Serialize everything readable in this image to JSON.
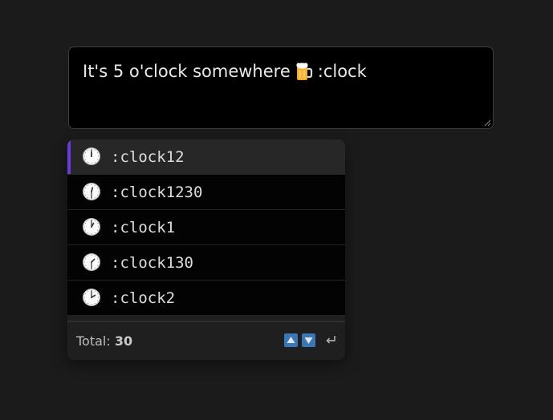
{
  "composer": {
    "text_before": "It's 5 o'clock somewhere",
    "emoji_icon": "beer-mug-icon",
    "text_after": ":clock"
  },
  "suggestions": [
    {
      "label": ":clock12",
      "icon": "clock-12-icon",
      "hour": 12,
      "minute": 0,
      "selected": true
    },
    {
      "label": ":clock1230",
      "icon": "clock-1230-icon",
      "hour": 12,
      "minute": 30,
      "selected": false
    },
    {
      "label": ":clock1",
      "icon": "clock-1-icon",
      "hour": 1,
      "minute": 0,
      "selected": false
    },
    {
      "label": ":clock130",
      "icon": "clock-130-icon",
      "hour": 1,
      "minute": 30,
      "selected": false
    },
    {
      "label": ":clock2",
      "icon": "clock-2-icon",
      "hour": 2,
      "minute": 0,
      "selected": false
    }
  ],
  "footer": {
    "total_label": "Total:",
    "total_count": "30",
    "nav_up_icon": "arrow-up-key-icon",
    "nav_down_icon": "arrow-down-key-icon",
    "enter_icon": "enter-key-icon"
  },
  "colors": {
    "page_bg": "#1b1b1b",
    "composer_bg": "#000000",
    "selected_accent": "#6a3bdc",
    "key_bg": "#3a78b5"
  }
}
